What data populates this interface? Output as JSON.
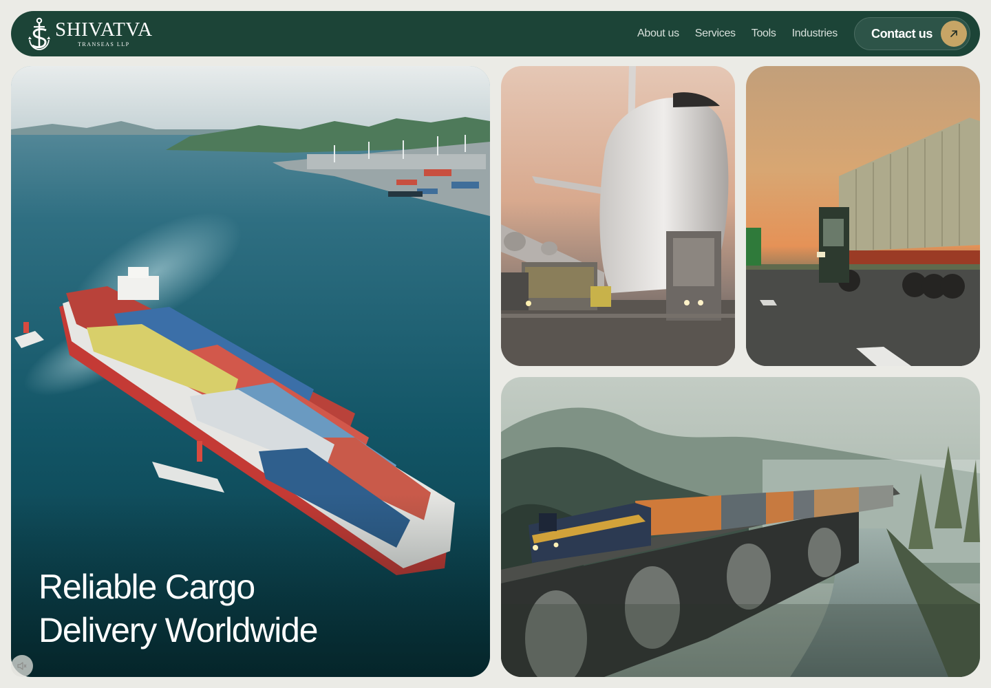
{
  "brand": {
    "name": "SHIVATVA",
    "subtitle": "TRANSEAS LLP",
    "logo_icon": "anchor-s-monogram-icon"
  },
  "nav": {
    "links": [
      "About us",
      "Services",
      "Tools",
      "Industries"
    ],
    "contact_label": "Contact us",
    "contact_icon": "arrow-up-right-icon"
  },
  "hero": {
    "title_line1": "Reliable Cargo",
    "title_line2": "Delivery Worldwide",
    "mute_icon": "speaker-muted-icon"
  },
  "images": [
    {
      "name": "cargo-ship-image"
    },
    {
      "name": "cargo-plane-image"
    },
    {
      "name": "container-truck-image"
    },
    {
      "name": "freight-train-image"
    }
  ],
  "colors": {
    "nav_bg": "#1c4437",
    "contact_bg": "#2d5448",
    "accent_gold": "#c7a566",
    "page_bg": "#ebebe6"
  }
}
